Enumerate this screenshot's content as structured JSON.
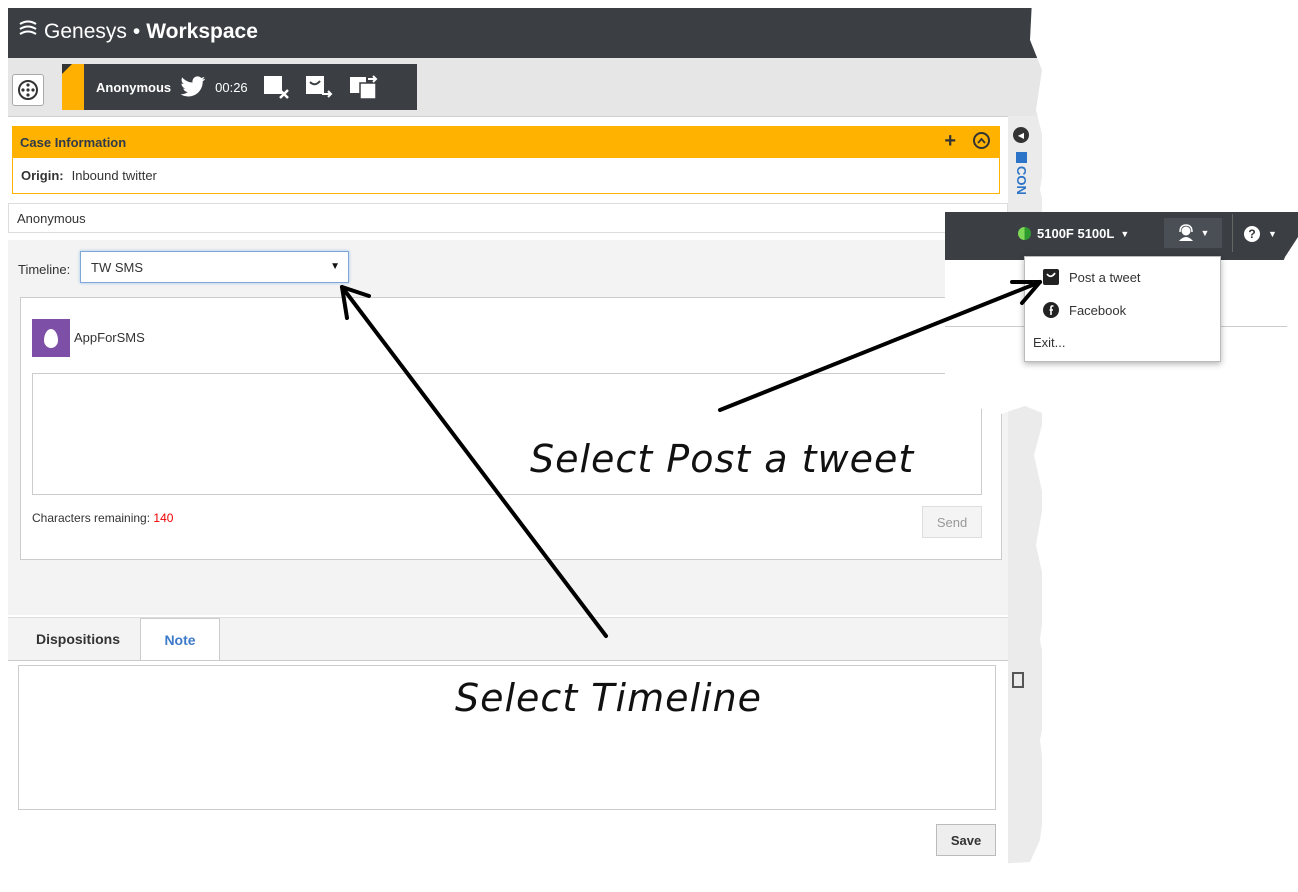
{
  "app": {
    "brand_name": "Genesys",
    "brand_separator": "•",
    "product": "Workspace"
  },
  "interaction": {
    "contact_name": "Anonymous",
    "channel_icon": "twitter-icon",
    "timer": "00:26"
  },
  "case_information": {
    "title": "Case Information",
    "add_label": "+",
    "origin_label": "Origin:",
    "origin_value": "Inbound twitter"
  },
  "contact_row": "Anonymous",
  "side_panel": {
    "contact_tab": "CON"
  },
  "timeline": {
    "label": "Timeline:",
    "selected": "TW SMS"
  },
  "tweet": {
    "account": "AppForSMS",
    "chars_label": "Characters remaining:",
    "chars_remaining": "140",
    "send_label": "Send"
  },
  "bottom_tabs": {
    "dispositions": "Dispositions",
    "note": "Note",
    "active": "Note",
    "save_label": "Save"
  },
  "callout": {
    "station": "5100F 5100L",
    "menu_items": [
      "Post a tweet",
      "Facebook",
      "Exit..."
    ]
  },
  "annotations": {
    "post_tweet": "Select Post a tweet",
    "timeline": "Select Timeline"
  },
  "colors": {
    "header_dark": "#3b3f44",
    "accent_orange": "#ffb300",
    "link_blue": "#3d7ac9",
    "chars_red": "#e00000",
    "avatar_purple": "#7d4fa6"
  }
}
